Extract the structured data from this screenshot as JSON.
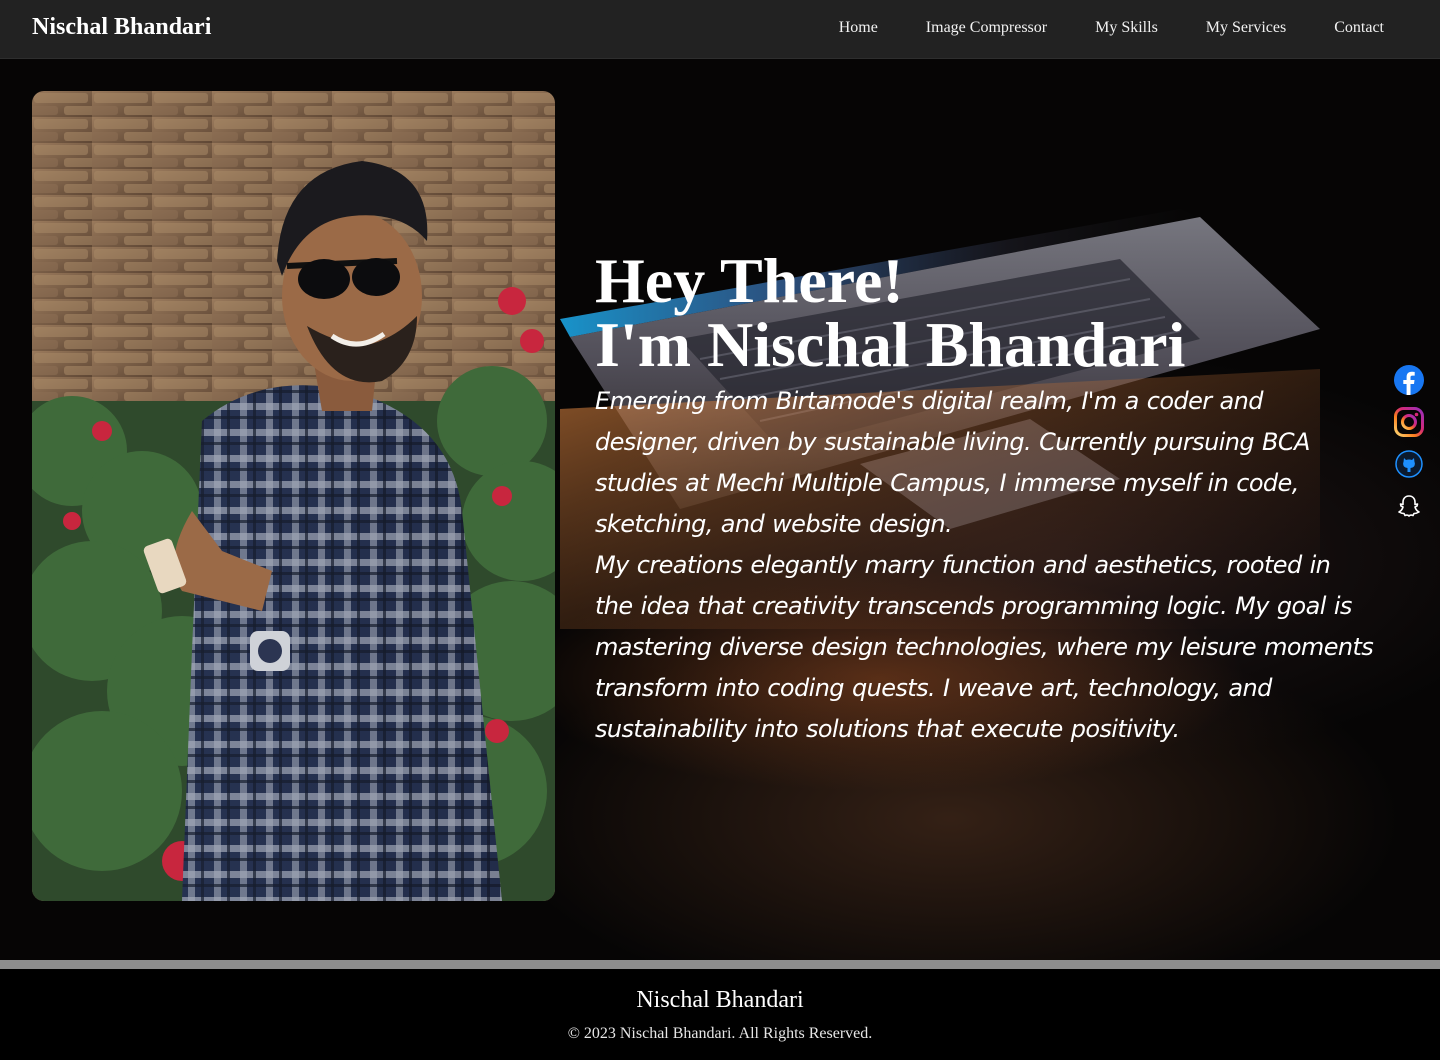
{
  "nav": {
    "brand": "Nischal Bhandari",
    "links": [
      "Home",
      "Image Compressor",
      "My Skills",
      "My Services",
      "Contact"
    ]
  },
  "hero": {
    "greeting": "Hey There!",
    "name_line": "I'm Nischal Bhandari",
    "bio": [
      "Emerging from Birtamode's digital realm, I'm a coder and designer, driven by sustainable living. Currently pursuing BCA studies at Mechi Multiple Campus, I immerse myself in code, sketching, and website design.",
      "My creations elegantly marry function and aesthetics, rooted in the idea that creativity transcends programming logic. My goal is mastering diverse design technologies, where my leisure moments transform into coding quests. I weave art, technology, and sustainability into solutions that execute positivity."
    ]
  },
  "socials": [
    {
      "icon": "facebook-icon",
      "color": "#1877f2"
    },
    {
      "icon": "instagram-icon",
      "color": "#e1306c"
    },
    {
      "icon": "github-icon",
      "color": "#1e90ff"
    },
    {
      "icon": "snapchat-icon",
      "color": "#ffffff"
    }
  ],
  "footer": {
    "name": "Nischal Bhandari",
    "copyright": "© 2023 Nischal Bhandari. All Rights Reserved."
  }
}
